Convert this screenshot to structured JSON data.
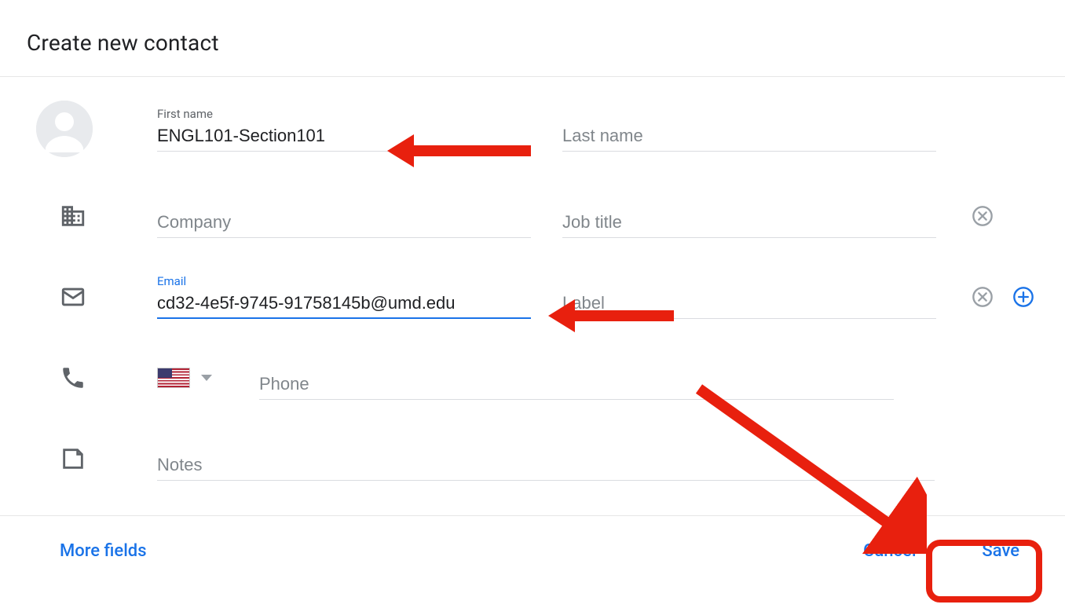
{
  "title": "Create new contact",
  "name_row": {
    "first_name_label": "First name",
    "first_name_value": "ENGL101-Section101",
    "last_name_placeholder": "Last name",
    "last_name_value": ""
  },
  "company_row": {
    "company_placeholder": "Company",
    "company_value": "",
    "job_title_placeholder": "Job title",
    "job_title_value": ""
  },
  "email_row": {
    "email_label": "Email",
    "email_value": "cd32-4e5f-9745-91758145b@umd.edu",
    "label_placeholder": "Label",
    "label_value": ""
  },
  "phone_row": {
    "phone_placeholder": "Phone",
    "phone_value": ""
  },
  "notes_row": {
    "notes_placeholder": "Notes",
    "notes_value": ""
  },
  "footer": {
    "more_fields": "More fields",
    "cancel": "Cancel",
    "save": "Save"
  },
  "icons": {
    "avatar": "person-icon",
    "company": "company-icon",
    "email": "email-icon",
    "phone": "phone-icon",
    "notes": "note-icon",
    "clear": "close-circle-icon",
    "add": "plus-circle-icon",
    "flag": "us-flag-icon",
    "caret": "chevron-down-icon"
  }
}
